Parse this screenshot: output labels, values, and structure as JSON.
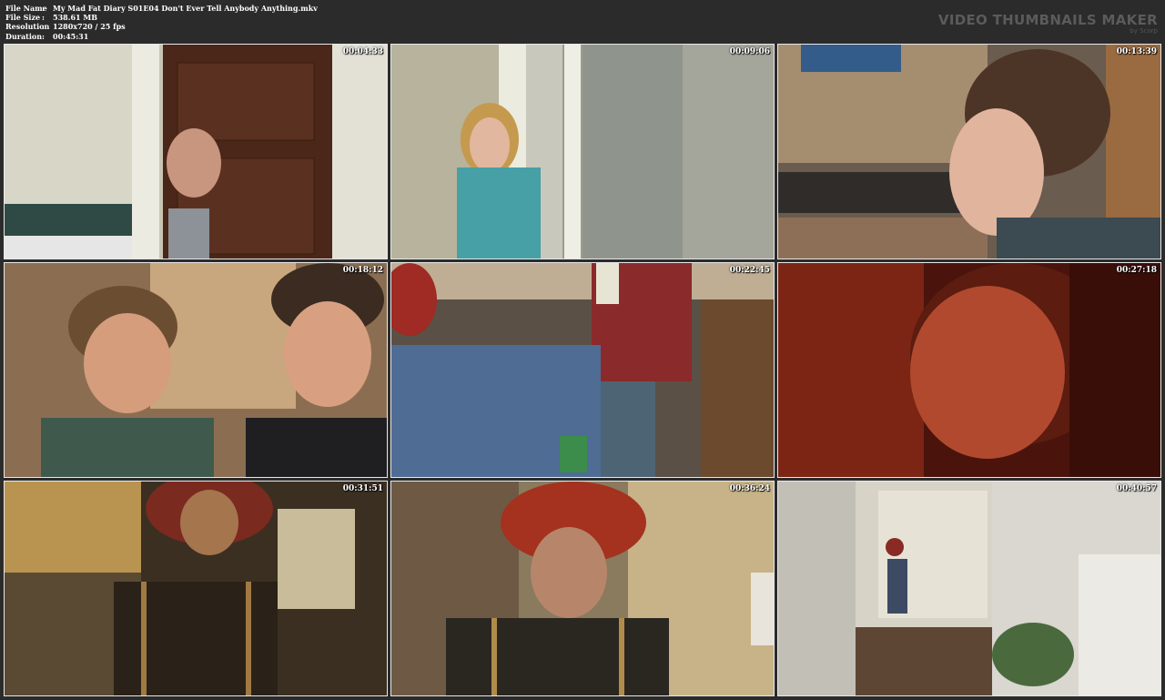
{
  "file_info": [
    {
      "key": "File Name",
      "value": "My Mad Fat Diary S01E04 Don't Ever Tell Anybody Anything.mkv"
    },
    {
      "key": "File Size",
      "value": "538.61 MB"
    },
    {
      "key": "Resolution",
      "value": "1280x720 / 25 fps"
    },
    {
      "key": "Duration",
      "value": "00:45:31"
    }
  ],
  "separator": ":",
  "brand": {
    "title": "VIDEO THUMBNAILS MAKER",
    "subtitle": "by Scorp"
  },
  "timestamps": [
    "00:04:33",
    "00:09:06",
    "00:13:39",
    "00:18:12",
    "00:22:45",
    "00:27:18",
    "00:31:51",
    "00:36:24",
    "00:40:57"
  ]
}
